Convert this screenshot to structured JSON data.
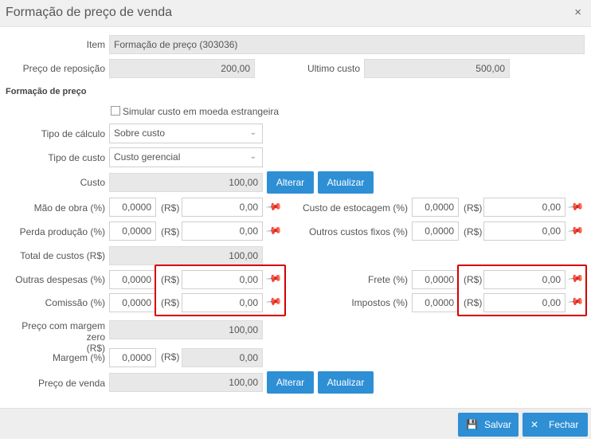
{
  "window": {
    "title": "Formação de preço de venda",
    "close_icon": "×"
  },
  "item": {
    "label": "Item",
    "value": "Formação de preço (303036)"
  },
  "preco_reposicao": {
    "label": "Preço de reposição",
    "value": "200,00"
  },
  "ultimo_custo": {
    "label": "Ultimo custo",
    "value": "500,00"
  },
  "section_title": "Formação de preço",
  "simular": {
    "label": "Simular custo em moeda estrangeira",
    "checked": false
  },
  "tipo_calculo": {
    "label": "Tipo de cálculo",
    "value": "Sobre custo"
  },
  "tipo_custo": {
    "label": "Tipo de custo",
    "value": "Custo gerencial"
  },
  "custo": {
    "label": "Custo",
    "value": "100,00"
  },
  "currency_label": "(R$)",
  "buttons": {
    "alterar": "Alterar",
    "atualizar": "Atualizar"
  },
  "mao_obra": {
    "label": "Mão de obra (%)",
    "pct": "0,0000",
    "rs": "0,00"
  },
  "perda_producao": {
    "label": "Perda produção (%)",
    "pct": "0,0000",
    "rs": "0,00"
  },
  "custo_estocagem": {
    "label": "Custo de estocagem (%)",
    "pct": "0,0000",
    "rs": "0,00"
  },
  "outros_custos_fixos": {
    "label": "Outros custos fixos (%)",
    "pct": "0,0000",
    "rs": "0,00"
  },
  "total_custos": {
    "label": "Total de custos (R$)",
    "value": "100,00"
  },
  "outras_despesas": {
    "label": "Outras despesas (%)",
    "pct": "0,0000",
    "rs": "0,00"
  },
  "comissao": {
    "label": "Comissão (%)",
    "pct": "0,0000",
    "rs": "0,00"
  },
  "frete": {
    "label": "Frete (%)",
    "pct": "0,0000",
    "rs": "0,00"
  },
  "impostos": {
    "label": "Impostos (%)",
    "pct": "0,0000",
    "rs": "0,00"
  },
  "preco_margem_zero": {
    "label_line1": "Preço com margem zero",
    "label_line2": "(R$)",
    "value": "100,00"
  },
  "margem": {
    "label": "Margem (%)",
    "pct": "0,0000",
    "rs": "0,00"
  },
  "preco_venda": {
    "label": "Preço de venda",
    "value": "100,00"
  },
  "footer": {
    "salvar": "Salvar",
    "fechar": "Fechar"
  },
  "icons": {
    "pin": "pin-icon",
    "save": "save-icon",
    "close": "close-icon",
    "chevron": "chevron-down-icon"
  },
  "colors": {
    "primary": "#2e8fd5",
    "highlight": "#d40000"
  }
}
